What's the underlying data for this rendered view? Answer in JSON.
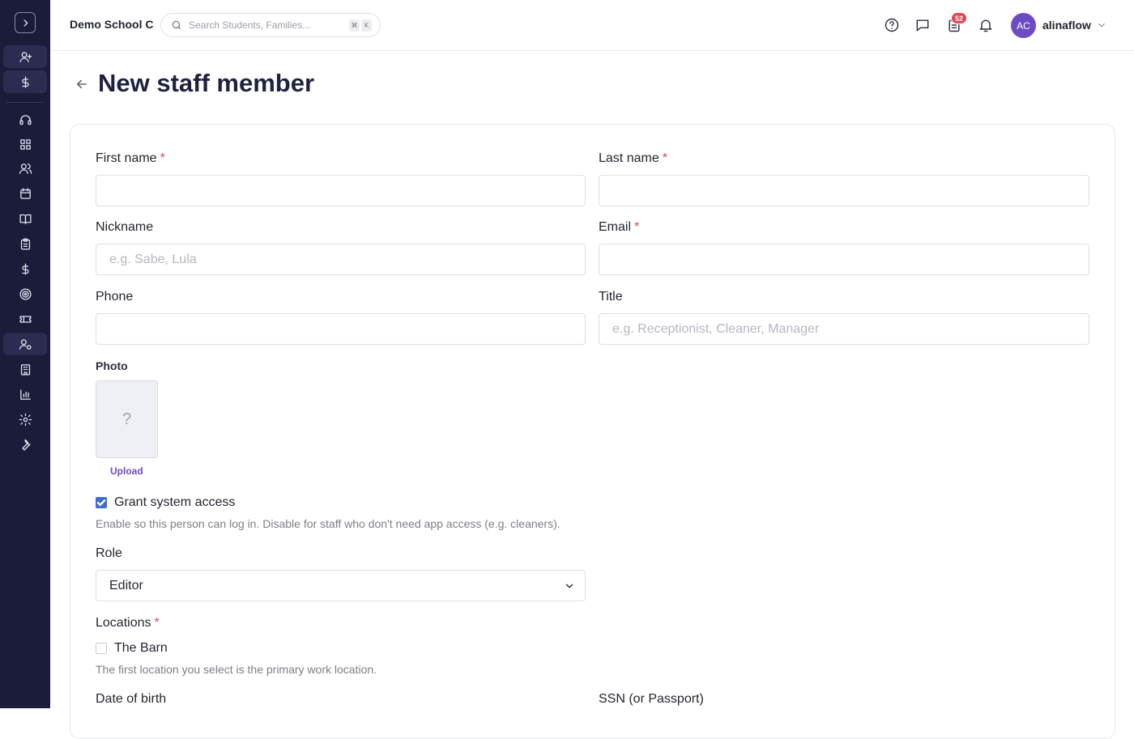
{
  "header": {
    "school_name": "Demo School C",
    "search_placeholder": "Search Students, Families...",
    "shortcut_keys": [
      "⌘",
      "K"
    ],
    "notification_count": "52",
    "user_initials": "AC",
    "user_name": "alinaflow"
  },
  "sidebar": {
    "icons": [
      "user-plus-icon",
      "dollar-icon",
      "headset-icon",
      "dashboard-icon",
      "users-icon",
      "calendar-icon",
      "book-icon",
      "clipboard-icon",
      "dollar-icon",
      "target-icon",
      "ticket-icon",
      "user-settings-icon",
      "building-icon",
      "chart-icon",
      "gear-icon",
      "wrench-icon"
    ],
    "active_item": "user-settings-icon"
  },
  "page": {
    "title": "New staff member"
  },
  "form": {
    "first_name_label": "First name",
    "last_name_label": "Last name",
    "nickname_label": "Nickname",
    "nickname_placeholder": "e.g. Sabe, Lula",
    "email_label": "Email",
    "phone_label": "Phone",
    "title_label": "Title",
    "title_placeholder": "e.g. Receptionist, Cleaner, Manager",
    "photo_label": "Photo",
    "photo_placeholder_glyph": "?",
    "upload_label": "Upload",
    "grant_access_label": "Grant system access",
    "grant_access_checked": true,
    "grant_access_help": "Enable so this person can log in. Disable for staff who don't need app access (e.g. cleaners).",
    "role_label": "Role",
    "role_value": "Editor",
    "locations_label": "Locations",
    "location_option": "The Barn",
    "location_checked": false,
    "locations_help": "The first location you select is the primary work location.",
    "dob_label": "Date of birth",
    "ssn_label": "SSN (or Passport)",
    "required_marker": "*"
  },
  "colors": {
    "sidebar_bg": "#1b1b3a",
    "accent": "#6c4bc4",
    "required": "#e0484e",
    "checkbox": "#3b6fd1"
  }
}
